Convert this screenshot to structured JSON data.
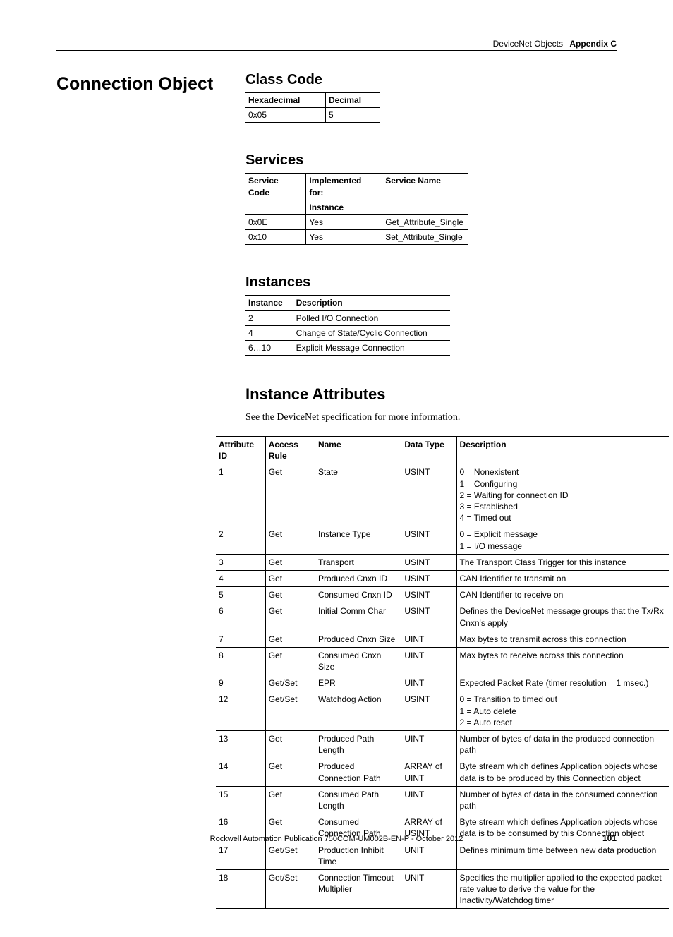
{
  "header": {
    "section": "DeviceNet Objects",
    "chapter": "Appendix C"
  },
  "mainTitle": "Connection Object",
  "classCode": {
    "title": "Class Code",
    "headers": {
      "hex": "Hexadecimal",
      "dec": "Decimal"
    },
    "row": {
      "hex": "0x05",
      "dec": "5"
    }
  },
  "servicesSection": {
    "title": "Services",
    "headers": {
      "code": "Service Code",
      "impl": "Implemented for:",
      "instance": "Instance",
      "name": "Service Name"
    },
    "rows": [
      {
        "code": "0x0E",
        "impl": "Yes",
        "name": "Get_Attribute_Single"
      },
      {
        "code": "0x10",
        "impl": "Yes",
        "name": "Set_Attribute_Single"
      }
    ]
  },
  "instancesSection": {
    "title": "Instances",
    "headers": {
      "inst": "Instance",
      "desc": "Description"
    },
    "rows": [
      {
        "inst": "2",
        "desc": "Polled I/O Connection"
      },
      {
        "inst": "4",
        "desc": "Change of State/Cyclic Connection"
      },
      {
        "inst": "6…10",
        "desc": "Explicit Message Connection"
      }
    ]
  },
  "attrSection": {
    "title": "Instance Attributes",
    "note": "See the DeviceNet specification for more information.",
    "headers": {
      "id": "Attribute ID",
      "rule": "Access Rule",
      "name": "Name",
      "dtype": "Data Type",
      "desc": "Description"
    },
    "rows": [
      {
        "id": "1",
        "rule": "Get",
        "name": "State",
        "dtype": "USINT",
        "desc": "0 = Nonexistent\n1 = Configuring\n2 = Waiting for connection ID\n3 = Established\n4 = Timed out"
      },
      {
        "id": "2",
        "rule": "Get",
        "name": "Instance Type",
        "dtype": "USINT",
        "desc": "0 = Explicit message\n1 = I/O message"
      },
      {
        "id": "3",
        "rule": "Get",
        "name": "Transport",
        "dtype": "USINT",
        "desc": "The Transport Class Trigger for this instance"
      },
      {
        "id": "4",
        "rule": "Get",
        "name": "Produced Cnxn ID",
        "dtype": "USINT",
        "desc": "CAN Identifier to transmit on"
      },
      {
        "id": "5",
        "rule": "Get",
        "name": "Consumed Cnxn ID",
        "dtype": "USINT",
        "desc": "CAN Identifier to receive on"
      },
      {
        "id": "6",
        "rule": "Get",
        "name": "Initial Comm Char",
        "dtype": "USINT",
        "desc": "Defines the DeviceNet message groups that the Tx/Rx Cnxn's apply"
      },
      {
        "id": "7",
        "rule": "Get",
        "name": "Produced Cnxn Size",
        "dtype": "UINT",
        "desc": "Max bytes to transmit across this connection"
      },
      {
        "id": "8",
        "rule": "Get",
        "name": "Consumed Cnxn Size",
        "dtype": "UINT",
        "desc": "Max bytes to receive across this connection"
      },
      {
        "id": "9",
        "rule": "Get/Set",
        "name": "EPR",
        "dtype": "UINT",
        "desc": "Expected Packet Rate (timer resolution = 1 msec.)"
      },
      {
        "id": "12",
        "rule": "Get/Set",
        "name": "Watchdog Action",
        "dtype": "USINT",
        "desc": "0 = Transition to timed out\n1 = Auto delete\n2 = Auto reset"
      },
      {
        "id": "13",
        "rule": "Get",
        "name": "Produced Path Length",
        "dtype": "UINT",
        "desc": "Number of bytes of data in the produced connection path"
      },
      {
        "id": "14",
        "rule": "Get",
        "name": "Produced Connection Path",
        "dtype": "ARRAY of UINT",
        "desc": "Byte stream which defines Application objects whose data is to be produced by this Connection object"
      },
      {
        "id": "15",
        "rule": "Get",
        "name": "Consumed Path Length",
        "dtype": "UINT",
        "desc": "Number of bytes of data in the consumed connection path"
      },
      {
        "id": "16",
        "rule": "Get",
        "name": "Consumed Connection Path",
        "dtype": "ARRAY of USINT",
        "desc": "Byte stream which defines Application objects whose data is to be consumed by this Connection object"
      },
      {
        "id": "17",
        "rule": "Get/Set",
        "name": "Production Inhibit Time",
        "dtype": "UNIT",
        "desc": "Defines minimum time between new data production"
      },
      {
        "id": "18",
        "rule": "Get/Set",
        "name": "Connection Timeout Multiplier",
        "dtype": "UNIT",
        "desc": "Specifies the multiplier applied to the expected packet rate value to derive the value for the Inactivity/Watchdog timer"
      }
    ]
  },
  "footer": {
    "pub": "Rockwell Automation Publication 750COM-UM002B-EN-P - October 2012",
    "page": "101"
  }
}
